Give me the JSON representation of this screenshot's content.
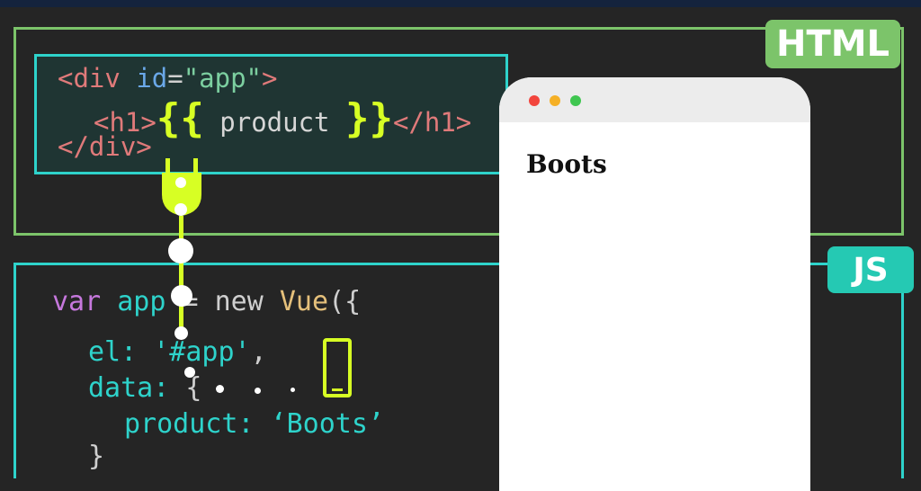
{
  "badges": {
    "html": "HTML",
    "js": "JS"
  },
  "html_code": {
    "line1": {
      "open": "<div",
      "attr": "id",
      "eq": "=",
      "value": "\"app\"",
      "close": ">"
    },
    "line2": {
      "open": "<h1>",
      "brace_open": "{{",
      "expr": " product ",
      "brace_close": "}}",
      "close": "</h1>"
    },
    "line3": {
      "close_tag": "</div>"
    }
  },
  "js_code": {
    "line1": {
      "kw": "var",
      "name": "app",
      "op": " = ",
      "new": "new",
      "cls": "Vue",
      "punc": "({"
    },
    "line2": {
      "prop": "el:",
      "value": "'#app'",
      "punc": ","
    },
    "line3": {
      "prop": "data:",
      "punc": " {"
    },
    "line4": {
      "prop": "product:",
      "value": "‘Boots’"
    },
    "line5": {
      "punc": "}"
    }
  },
  "browser": {
    "heading": "Boots"
  },
  "colors": {
    "html_accent": "#7cc46a",
    "js_accent": "#2ed3cb",
    "vue_highlight": "#d7ff24",
    "background": "#252525"
  },
  "icons": {
    "plug": "plug-icon",
    "phone": "mobile-phone-icon"
  }
}
